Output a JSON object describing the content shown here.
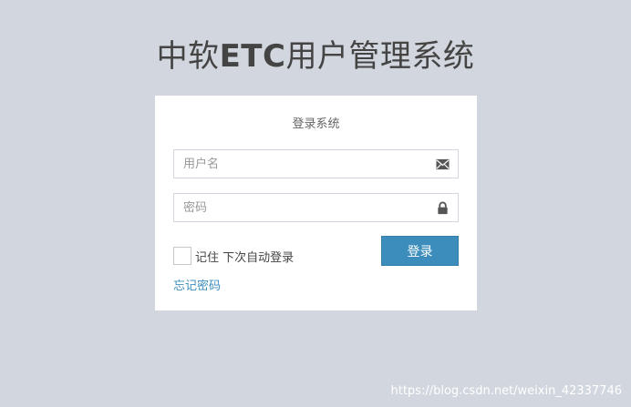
{
  "header": {
    "title_prefix": "中软",
    "title_bold": "ETC",
    "title_suffix": "用户管理系统"
  },
  "login": {
    "message": "登录系统",
    "username_placeholder": "用户名",
    "username_value": "",
    "password_placeholder": "密码",
    "password_value": "",
    "username_icon": "envelope-icon",
    "password_icon": "lock-icon",
    "remember_label": "记住 下次自动登录",
    "remember_checked": false,
    "submit_label": "登录",
    "forgot_label": "忘记密码"
  },
  "watermark": {
    "text": "https://blog.csdn.net/weixin_42337746"
  },
  "colors": {
    "background": "#d2d6de",
    "primary": "#3c8dbc",
    "box": "#ffffff"
  }
}
